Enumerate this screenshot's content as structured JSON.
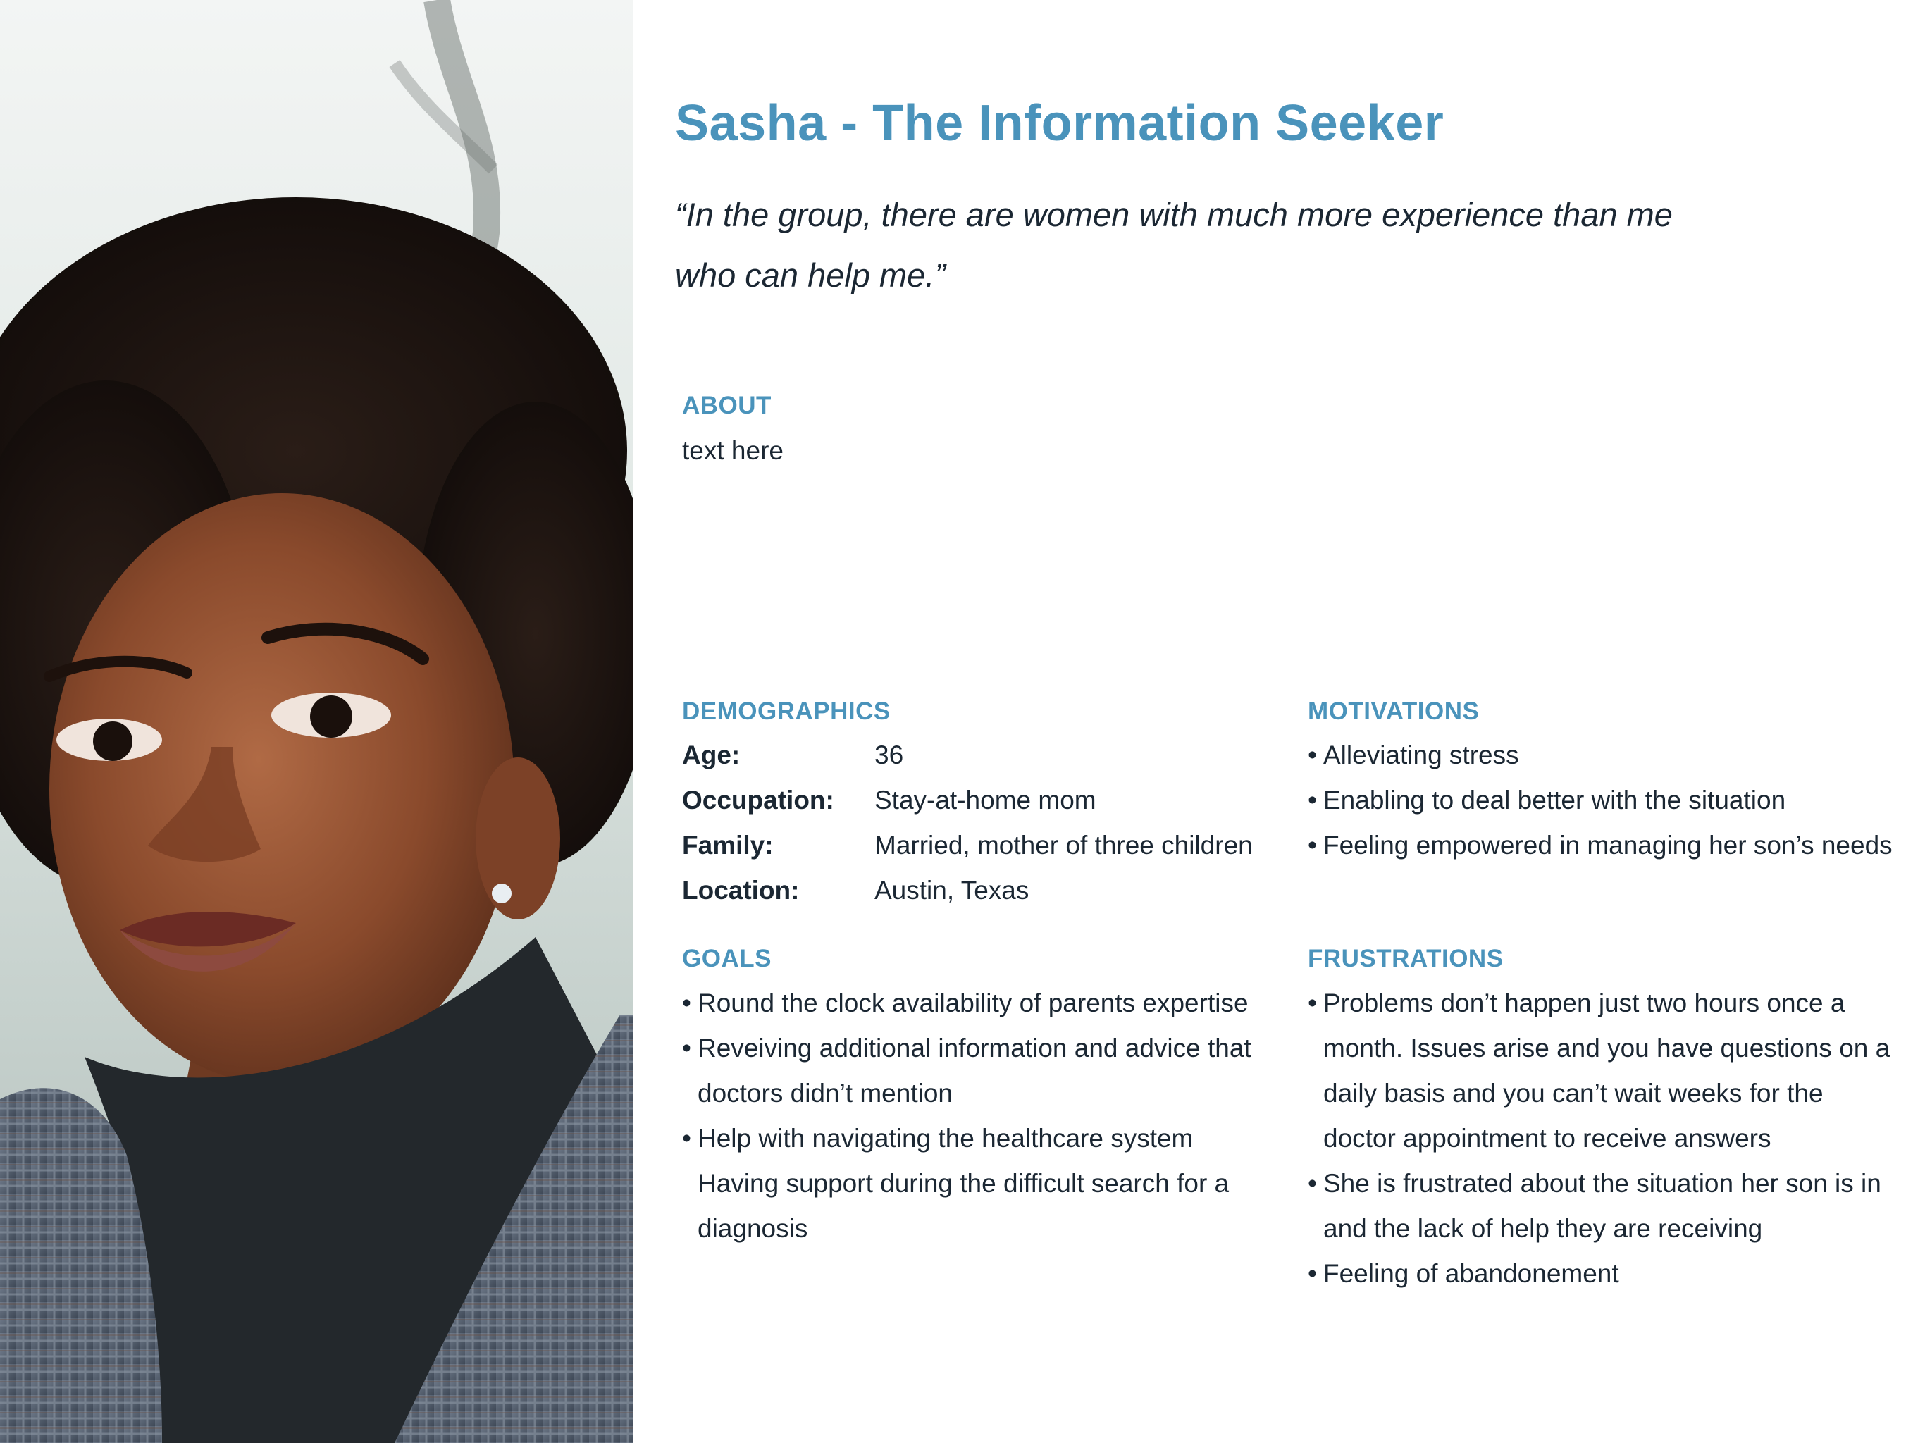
{
  "persona": {
    "title": "Sasha - The Information Seeker",
    "quote": "“In the group, there are women with much more experience than me who can help me.”"
  },
  "about": {
    "heading": "ABOUT",
    "text": "text here"
  },
  "demographics": {
    "heading": "DEMOGRAPHICS",
    "rows": [
      {
        "label": "Age:",
        "value": "36"
      },
      {
        "label": "Occupation:",
        "value": "Stay-at-home mom"
      },
      {
        "label": "Family:",
        "value": "Married, mother of three children"
      },
      {
        "label": "Location:",
        "value": "Austin, Texas"
      }
    ]
  },
  "motivations": {
    "heading": "MOTIVATIONS",
    "items": [
      "Alleviating stress",
      "Enabling to deal better with the situation",
      "Feeling empowered in managing her son’s needs"
    ]
  },
  "goals": {
    "heading": "GOALS",
    "items": [
      "Round the clock availability of parents expertise",
      "Reveiving additional information and advice that doctors didn’t mention",
      "Help with navigating the healthcare system"
    ],
    "extra_line": "Having support during the difficult search for a diagnosis"
  },
  "frustrations": {
    "heading": "FRUSTRATIONS",
    "items": [
      "Problems don’t happen just two hours once a month. Issues arise and you have questions on a daily basis and you can’t wait weeks for the doctor appointment to receive answers",
      "She is frustrated about the situation her son is in and the lack of help they are receiving",
      "Feeling of abandonement"
    ]
  },
  "bullet_glyph": "•",
  "colors": {
    "accent": "#4a93bb",
    "text": "#1b2733"
  },
  "photo": {
    "icon": "persona-portrait-photo"
  }
}
